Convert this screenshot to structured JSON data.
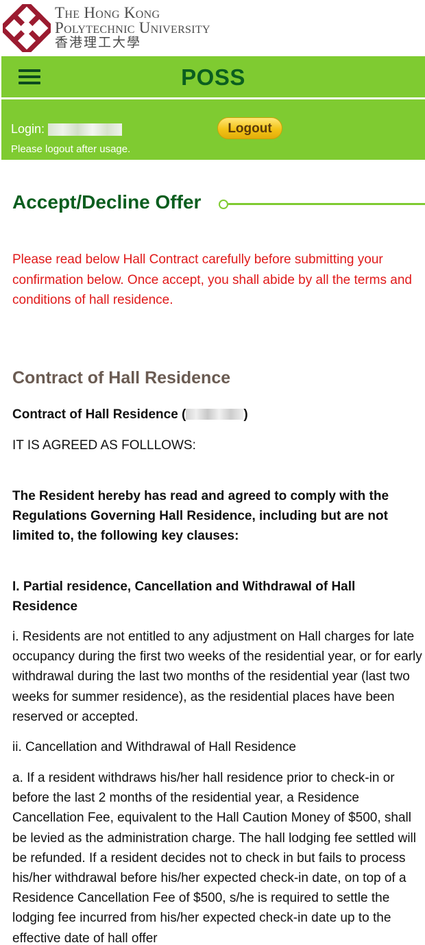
{
  "header": {
    "logo_line1": "The Hong Kong",
    "logo_line2": "Polytechnic University",
    "logo_line3": "香港理工大學"
  },
  "nav": {
    "title": "POSS",
    "menu_icon": "hamburger-menu-icon"
  },
  "login": {
    "label": "Login:",
    "logout_label": "Logout",
    "hint": "Please logout after usage."
  },
  "main": {
    "title": "Accept/Decline Offer",
    "warning": "Please read below Hall Contract carefully before submitting your confirmation below. Once accept, you shall abide by all the terms and conditions of hall residence.",
    "contract_heading": "Contract of Hall Residence",
    "contract_subtitle_prefix": "Contract of Hall Residence (",
    "contract_subtitle_suffix": ")",
    "agreed": "IT IS AGREED AS FOLLLOWS:",
    "resident_statement": "The Resident hereby has read and agreed to comply with the Regulations Governing Hall Residence, including but are not limited to, the following key clauses:",
    "section1_title": "I. Partial residence, Cancellation and Withdrawal of Hall Residence",
    "clause_i": "i. Residents are not entitled to any adjustment on Hall charges for late occupancy during the first two weeks of the residential year, or for early withdrawal during the last two months of the residential year (last two weeks for summer residence), as the residential places have been reserved or accepted.",
    "clause_ii": "ii. Cancellation and Withdrawal of Hall Residence",
    "clause_a": "a. If a resident withdraws his/her hall residence prior to check-in or before the last 2 months of the residential year, a Residence Cancellation Fee, equivalent to the Hall Caution Money of $500, shall be levied as the administration charge. The hall lodging fee settled will be refunded. If a resident decides not to check in but fails to process his/her withdrawal before his/her expected check-in date, on top of a Residence Cancellation Fee of $500, s/he is required to settle the lodging fee incurred from his/her expected check-in date up to the effective date of hall offer"
  },
  "colors": {
    "brand_green": "#7fcb31",
    "title_green": "#0b5e1f",
    "warning_red": "#e01a1a",
    "logout_gold": "#f3c317",
    "logo_maroon": "#9b1b30"
  }
}
